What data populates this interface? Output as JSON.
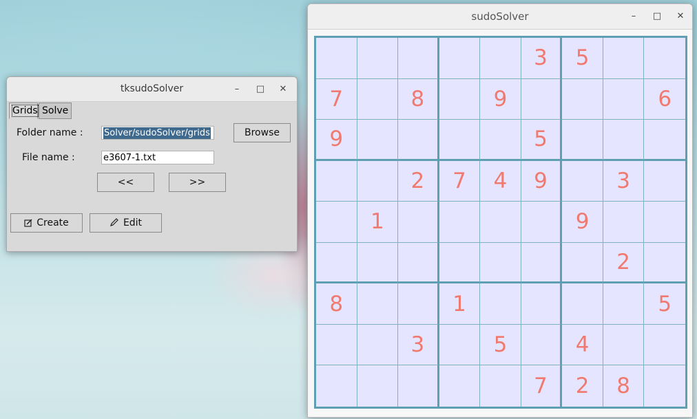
{
  "tk_window": {
    "title": "tksudoSolver",
    "controls": {
      "minimize": "–",
      "maximize": "□",
      "close": "✕"
    },
    "tabs": [
      {
        "label": "Grids",
        "active": true
      },
      {
        "label": "Solve",
        "active": false
      }
    ],
    "folder_label": "Folder name :",
    "folder_value": "Solver/sudoSolver/grids",
    "browse_label": "Browse",
    "file_label": "File name :",
    "file_value": "e3607-1.txt",
    "prev_label": "<<",
    "next_label": ">>",
    "create_label": "Create",
    "edit_label": "Edit"
  },
  "sudoku_window": {
    "title": "sudoSolver",
    "controls": {
      "minimize": "–",
      "maximize": "□",
      "close": "✕"
    },
    "grid": [
      [
        "",
        "",
        "",
        "",
        "",
        "3",
        "5",
        "",
        ""
      ],
      [
        "7",
        "",
        "8",
        "",
        "9",
        "",
        "",
        "",
        "6"
      ],
      [
        "9",
        "",
        "",
        "",
        "",
        "5",
        "",
        "",
        ""
      ],
      [
        "",
        "",
        "2",
        "7",
        "4",
        "9",
        "",
        "3",
        ""
      ],
      [
        "",
        "1",
        "",
        "",
        "",
        "",
        "9",
        "",
        ""
      ],
      [
        "",
        "",
        "",
        "",
        "",
        "",
        "",
        "2",
        ""
      ],
      [
        "8",
        "",
        "",
        "1",
        "",
        "",
        "",
        "",
        "5"
      ],
      [
        "",
        "",
        "3",
        "",
        "5",
        "",
        "4",
        "",
        ""
      ],
      [
        "",
        "",
        "",
        "",
        "",
        "7",
        "2",
        "8",
        ""
      ]
    ]
  },
  "colors": {
    "digit": "#f07a6f",
    "cell_bg": "#e6e5ff",
    "grid_line": "#5f9fb4"
  }
}
